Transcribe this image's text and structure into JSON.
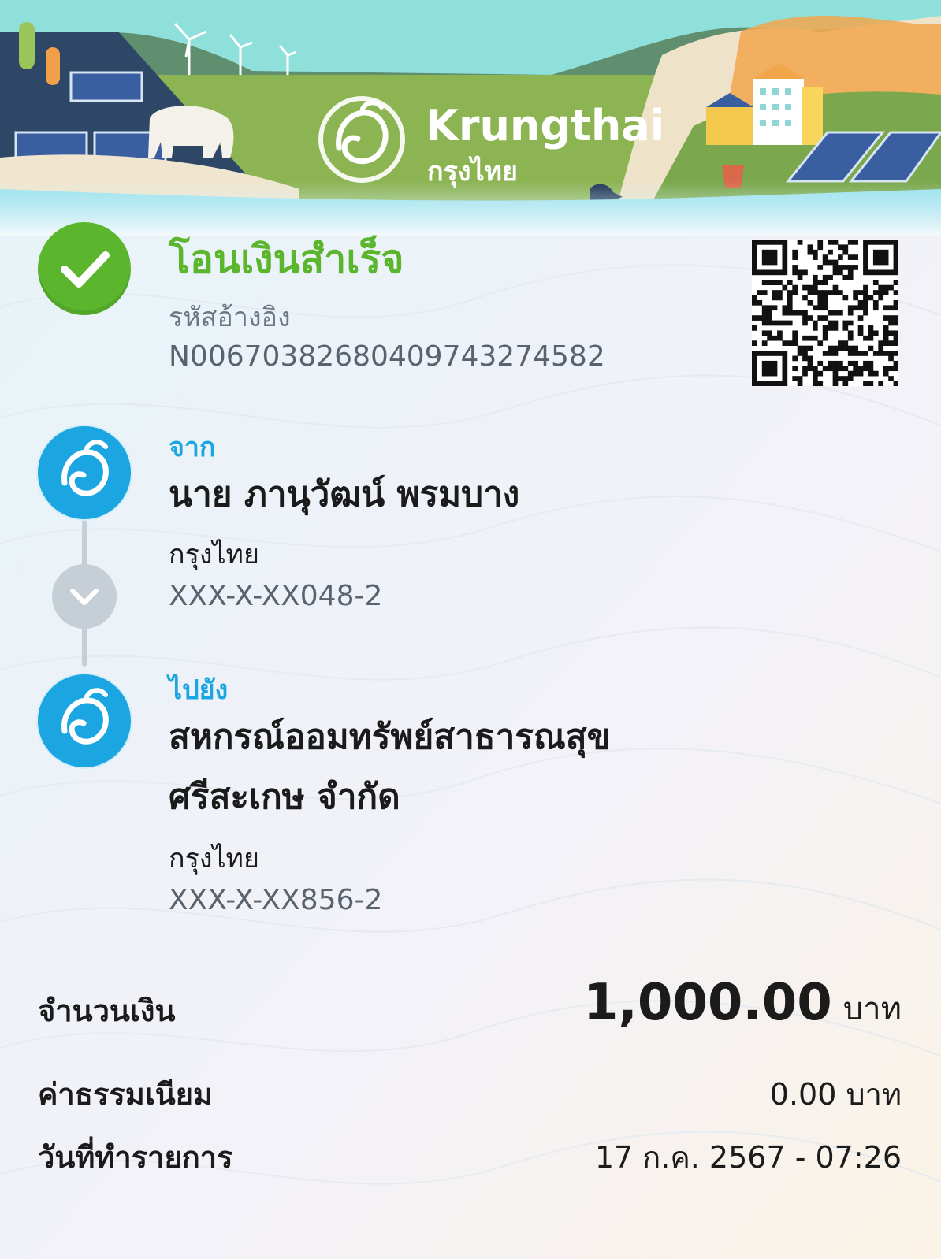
{
  "brand": {
    "name": "Krungthai",
    "name_thai": "กรุงไทย"
  },
  "status": {
    "title": "โอนเงินสำเร็จ",
    "ref_label": "รหัสอ้างอิง",
    "ref_value": "N0067038268040974327458​2"
  },
  "from": {
    "label": "จาก",
    "name": "นาย ภานุวัฒน์ พรมบาง",
    "bank": "กรุงไทย",
    "account": "XXX-X-XX048-2"
  },
  "to": {
    "label": "ไปยัง",
    "name_line1": "สหกรณ์ออมทรัพย์สาธารณสุข",
    "name_line2": "ศรีสะเกษ จำกัด",
    "bank": "กรุงไทย",
    "account": "XXX-X-XX856-2"
  },
  "summary": {
    "amount_label": "จำนวนเงิน",
    "amount_value": "1,000.00",
    "amount_unit": "บาท",
    "fee_label": "ค่าธรรมเนียม",
    "fee_value": "0.00 บาท",
    "date_label": "วันที่ทำรายการ",
    "date_value": "17 ก.ค. 2567 - 07:26"
  },
  "colors": {
    "success": "#5bb52d",
    "accent": "#1ba5e1",
    "muted": "#59636e",
    "connector": "#c6ced6"
  },
  "icons": {
    "status": "check-icon",
    "bank": "krungthai-logo-icon",
    "arrow": "chevron-down-icon",
    "qr": "qr-code-icon"
  }
}
